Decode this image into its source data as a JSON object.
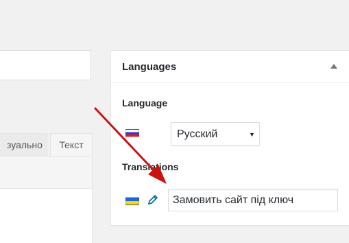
{
  "editor": {
    "tabs": [
      {
        "label": "зуально"
      },
      {
        "label": "Текст"
      }
    ]
  },
  "languages_panel": {
    "title": "Languages",
    "toggle_icon": "triangle-up-icon",
    "language_label": "Language",
    "language_flag": "flag-russia-icon",
    "language_select": {
      "value": "Русский",
      "arrow": "▼"
    },
    "translations_label": "Translations",
    "translation_flag": "flag-ukraine-icon",
    "translation_edit_icon": "pencil-icon",
    "translation_value": "Замовить сайт під ключ"
  },
  "annotation": {
    "arrow_color": "#cc1111"
  }
}
